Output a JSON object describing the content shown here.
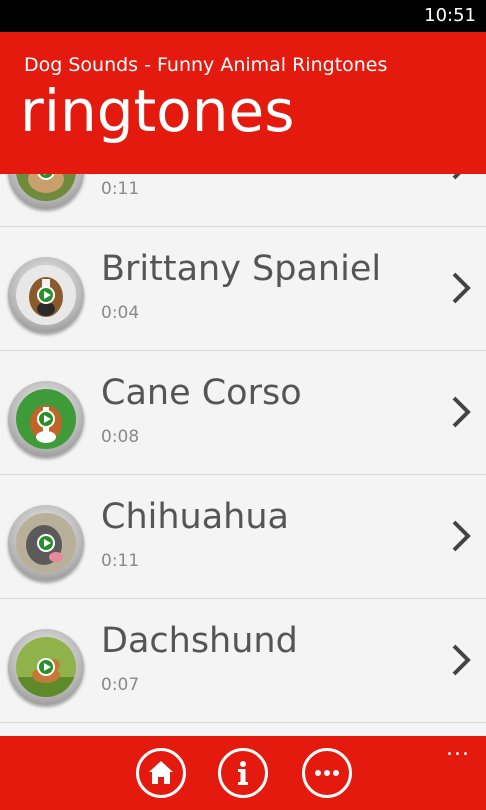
{
  "status_bar": {
    "time": "10:51"
  },
  "header": {
    "app_title": "Dog Sounds - Funny Animal Ringtones",
    "page_title": "ringtones"
  },
  "ringtones": [
    {
      "name": "",
      "duration": "0:11"
    },
    {
      "name": "Brittany Spaniel",
      "duration": "0:04"
    },
    {
      "name": "Cane Corso",
      "duration": "0:08"
    },
    {
      "name": "Chihuahua",
      "duration": "0:11"
    },
    {
      "name": "Dachshund",
      "duration": "0:07"
    }
  ],
  "app_bar": {
    "buttons": [
      {
        "icon": "home-icon"
      },
      {
        "icon": "info-icon"
      },
      {
        "icon": "more-icon"
      }
    ],
    "more_label": "..."
  },
  "colors": {
    "accent": "#e41a0e",
    "background": "#f4f4f4"
  }
}
